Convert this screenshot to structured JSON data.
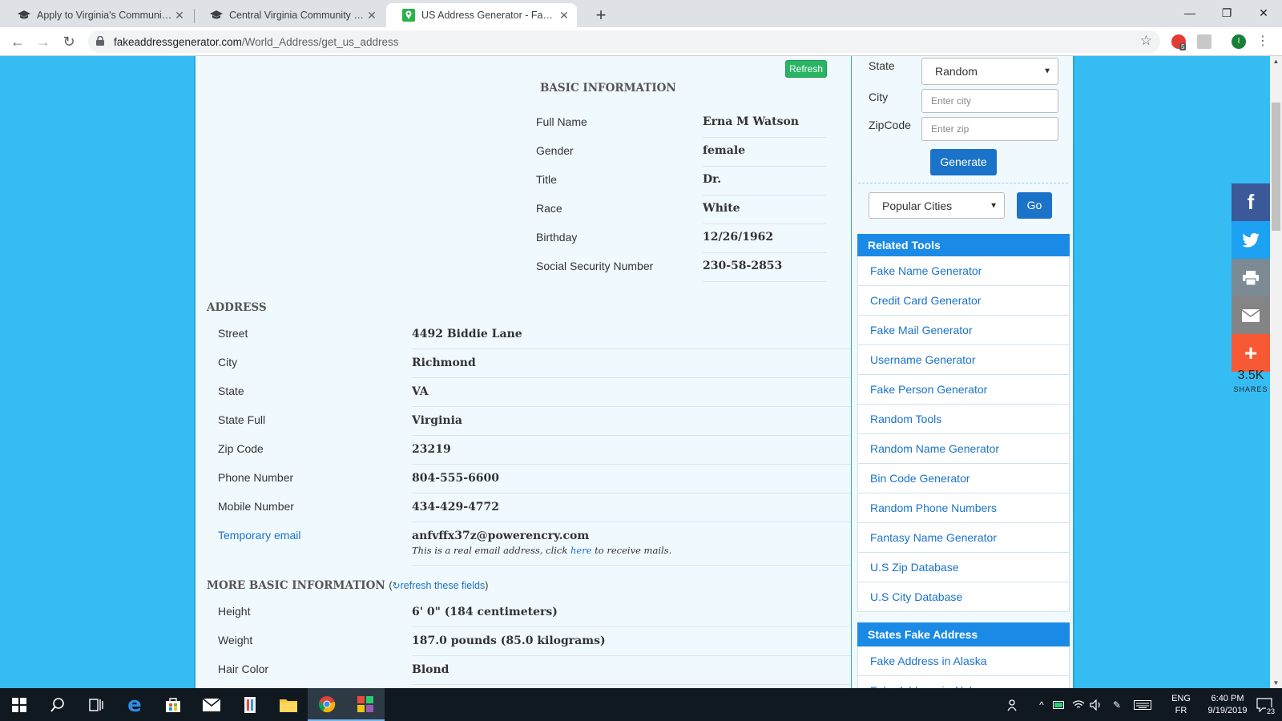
{
  "browser": {
    "tabs": [
      {
        "title": "Apply to Virginia's Community C",
        "icon": "graduation-cap-icon",
        "active": false
      },
      {
        "title": "Central Virginia Community Colle",
        "icon": "graduation-cap-icon",
        "active": false
      },
      {
        "title": "US Address Generator - Fake Ad",
        "icon": "map-pin-icon",
        "active": true
      }
    ],
    "url_domain": "fakeaddressgenerator.com",
    "url_path": "/World_Address/get_us_address",
    "extension_badge": "5",
    "profile_initial": "I"
  },
  "main": {
    "refresh_label": "Refresh",
    "basic_heading": "BASIC INFORMATION",
    "basic": [
      {
        "label": "Full Name",
        "value": "Erna M Watson"
      },
      {
        "label": "Gender",
        "value": "female"
      },
      {
        "label": "Title",
        "value": "Dr."
      },
      {
        "label": "Race",
        "value": "White"
      },
      {
        "label": "Birthday",
        "value": "12/26/1962"
      },
      {
        "label": "Social Security Number",
        "value": "230-58-2853"
      }
    ],
    "address_heading": "ADDRESS",
    "address": [
      {
        "label": "Street",
        "value": "4492  Biddie Lane"
      },
      {
        "label": "City",
        "value": "Richmond"
      },
      {
        "label": "State",
        "value": "VA"
      },
      {
        "label": "State Full",
        "value": "Virginia"
      },
      {
        "label": "Zip Code",
        "value": "23219"
      },
      {
        "label": "Phone Number",
        "value": "804-555-6600"
      },
      {
        "label": "Mobile Number",
        "value": "434-429-4772"
      },
      {
        "label": "Temporary email",
        "value": "anfvffx37z@powerencry.com"
      }
    ],
    "email_note_pre": "This is a real email address, click ",
    "email_note_link": "here",
    "email_note_post": " to receive mails.",
    "more_heading": "MORE BASIC INFORMATION",
    "more_refresh_link": "refresh these fields",
    "more": [
      {
        "label": "Height",
        "value": "6' 0\" (184 centimeters)"
      },
      {
        "label": "Weight",
        "value": "187.0 pounds (85.0 kilograms)"
      },
      {
        "label": "Hair Color",
        "value": "Blond"
      }
    ]
  },
  "sidebar": {
    "state_label": "State",
    "state_value": "Random",
    "city_label": "City",
    "city_placeholder": "Enter city",
    "zip_label": "ZipCode",
    "zip_placeholder": "Enter zip",
    "generate_label": "Generate",
    "popular_value": "Popular Cities",
    "go_label": "Go",
    "related_heading": "Related Tools",
    "related": [
      "Fake Name Generator",
      "Credit Card Generator",
      "Fake Mail Generator",
      "Username Generator",
      "Fake Person Generator",
      "Random Tools",
      "Random Name Generator",
      "Bin Code Generator",
      "Random Phone Numbers",
      "Fantasy Name Generator",
      "U.S Zip Database",
      "U.S City Database"
    ],
    "states_heading": "States Fake Address",
    "states": [
      "Fake Address in Alaska",
      "Fake Address in Alab"
    ]
  },
  "share": {
    "count": "3.5K",
    "label": "SHARES",
    "colors": {
      "facebook": "#3b5998",
      "twitter": "#1da1f2",
      "print": "#7c8a93",
      "email": "#848484",
      "more": "#f75935"
    }
  },
  "taskbar": {
    "lang": "ENG",
    "layout": "FR",
    "time": "6:40 PM",
    "date": "9/19/2019",
    "notifications": "23"
  }
}
